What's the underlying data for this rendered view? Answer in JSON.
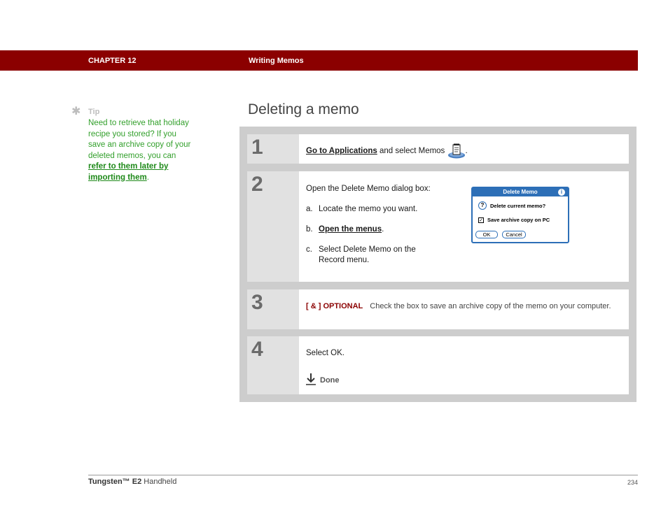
{
  "header": {
    "chapter": "CHAPTER 12",
    "section": "Writing Memos",
    "bar_color": "#8b0000"
  },
  "tip": {
    "icon": "asterisk-icon",
    "label": "Tip",
    "text": "Need to retrieve that holiday recipe you stored? If you save an archive copy of your deleted memos, you can ",
    "link": "refer to them later by importing them",
    "end": "."
  },
  "page_title": "Deleting a memo",
  "steps": [
    {
      "number": "1",
      "link": "Go to Applications",
      "text": " and select Memos ",
      "icon": "memos-icon",
      "end": "."
    },
    {
      "number": "2",
      "intro": "Open the Delete Memo dialog box:",
      "substeps": [
        {
          "letter": "a.",
          "text": "Locate the memo you want."
        },
        {
          "letter": "b.",
          "link": "Open the menus",
          "end": "."
        },
        {
          "letter": "c.",
          "text": "Select Delete Memo on the Record menu."
        }
      ],
      "dialog": {
        "title": "Delete Memo",
        "question": "Delete current memo?",
        "checkbox_label": "Save archive copy on PC",
        "checkbox_checked": true,
        "ok": "OK",
        "cancel": "Cancel"
      }
    },
    {
      "number": "3",
      "tag": "[ & ]  OPTIONAL",
      "text": "Check the box to save an archive copy of the memo on your computer."
    },
    {
      "number": "4",
      "text": "Select OK.",
      "done": "Done"
    }
  ],
  "footer": {
    "product": "Tungsten™ E2",
    "suffix": " Handheld",
    "page": "234"
  }
}
